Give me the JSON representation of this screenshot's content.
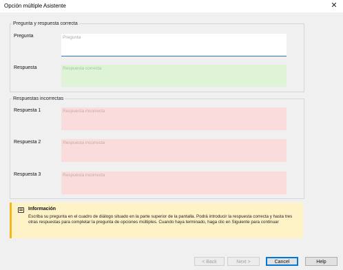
{
  "window": {
    "title": "Opción múltiple Asistente",
    "close_glyph": "✕"
  },
  "question_group": {
    "legend": "Pregunta y respuesta correcta",
    "question_label": "Pregunta",
    "question_placeholder": "Pregunta",
    "answer_label": "Respuesta",
    "answer_placeholder": "Respuesta correcta"
  },
  "wrong_group": {
    "legend": "Respuestas incorrectas",
    "items": [
      {
        "label": "Respuesta 1",
        "placeholder": "Respuesta incorrecta"
      },
      {
        "label": "Respuesta 2",
        "placeholder": "Respuesta incorrecta"
      },
      {
        "label": "Respuesta 3",
        "placeholder": "Respuesta incorrecta"
      }
    ]
  },
  "info": {
    "icon": "note-icon",
    "title": "Información",
    "text": "Escriba su pregunta en el cuadro de diálogo situado en la parte superior de la pantalla. Podrá introducir la respuesta correcta y hasta tres otras respuestas para completar la pregunta de opciones múltiples. Cuando haya terminado, haga clic en Siguiente para continuar"
  },
  "buttons": {
    "back": "< Back",
    "next": "Next >",
    "cancel": "Cancel",
    "help": "Help"
  },
  "colors": {
    "correct_answer_bg": "#dff3d7",
    "wrong_answer_bg": "#fadcdc",
    "info_bg": "#fef3c7",
    "info_accent": "#f3b71b",
    "focus_accent": "#2b79c4"
  }
}
